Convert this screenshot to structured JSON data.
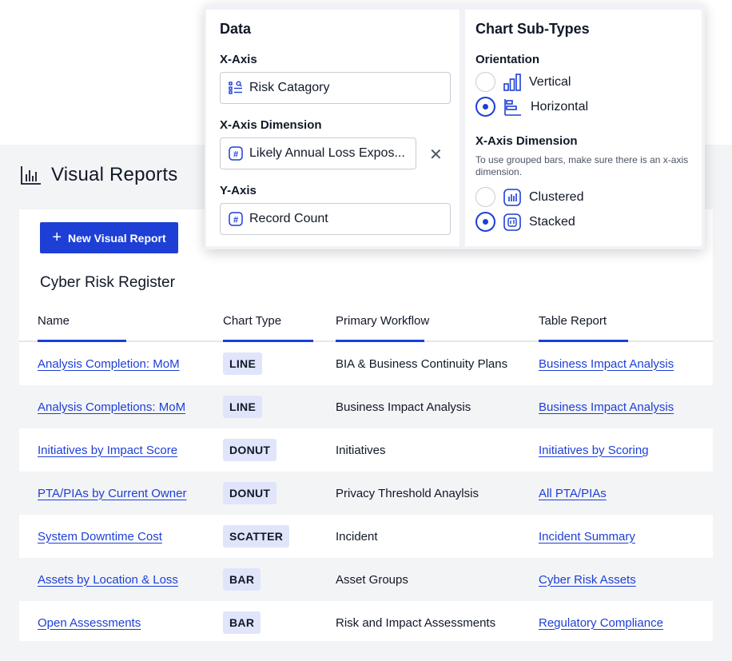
{
  "page": {
    "title": "Visual Reports",
    "title_icon": "bar-chart-icon",
    "new_button_label": "New Visual Report",
    "section_title": "Cyber Risk Register"
  },
  "table": {
    "headers": [
      "Name",
      "Chart Type",
      "Primary Workflow",
      "Table Report"
    ],
    "rows": [
      {
        "name": "Analysis Completion: MoM",
        "chart_type": "LINE",
        "workflow": "BIA & Business Continuity Plans",
        "report": "Business Impact Analysis"
      },
      {
        "name": "Analysis Completions: MoM",
        "chart_type": "LINE",
        "workflow": "Business Impact Analysis",
        "report": "Business Impact Analysis"
      },
      {
        "name": "Initiatives by Impact Score",
        "chart_type": "DONUT",
        "workflow": "Initiatives",
        "report": "Initiatives by Scoring"
      },
      {
        "name": "PTA/PIAs by Current Owner",
        "chart_type": "DONUT",
        "workflow": "Privacy Threshold Anaylsis",
        "report": "All PTA/PIAs"
      },
      {
        "name": "System Downtime Cost",
        "chart_type": "SCATTER",
        "workflow": "Incident",
        "report": "Incident Summary"
      },
      {
        "name": "Assets by Location & Loss",
        "chart_type": "BAR",
        "workflow": "Asset Groups",
        "report": "Cyber Risk Assets"
      },
      {
        "name": "Open Assessments",
        "chart_type": "BAR",
        "workflow": "Risk and Impact Assessments",
        "report": "Regulatory Compliance"
      }
    ]
  },
  "panel": {
    "data": {
      "heading": "Data",
      "x_axis_label": "X-Axis",
      "x_axis_value": "Risk Catagory",
      "x_dim_label": "X-Axis Dimension",
      "x_dim_value": "Likely Annual Loss Expos...",
      "y_axis_label": "Y-Axis",
      "y_axis_value": "Record Count"
    },
    "subtypes": {
      "heading": "Chart Sub-Types",
      "orientation_label": "Orientation",
      "vertical_label": "Vertical",
      "horizontal_label": "Horizontal",
      "orientation_selected": "Horizontal",
      "dimension_label": "X-Axis Dimension",
      "dimension_hint": "To use grouped bars, make sure there is an x-axis dimension.",
      "clustered_label": "Clustered",
      "stacked_label": "Stacked",
      "grouping_selected": "Stacked"
    }
  },
  "colors": {
    "accent": "#1d3fd6",
    "pill_bg": "#e0e5fb",
    "stripe": "#f3f4f6"
  }
}
